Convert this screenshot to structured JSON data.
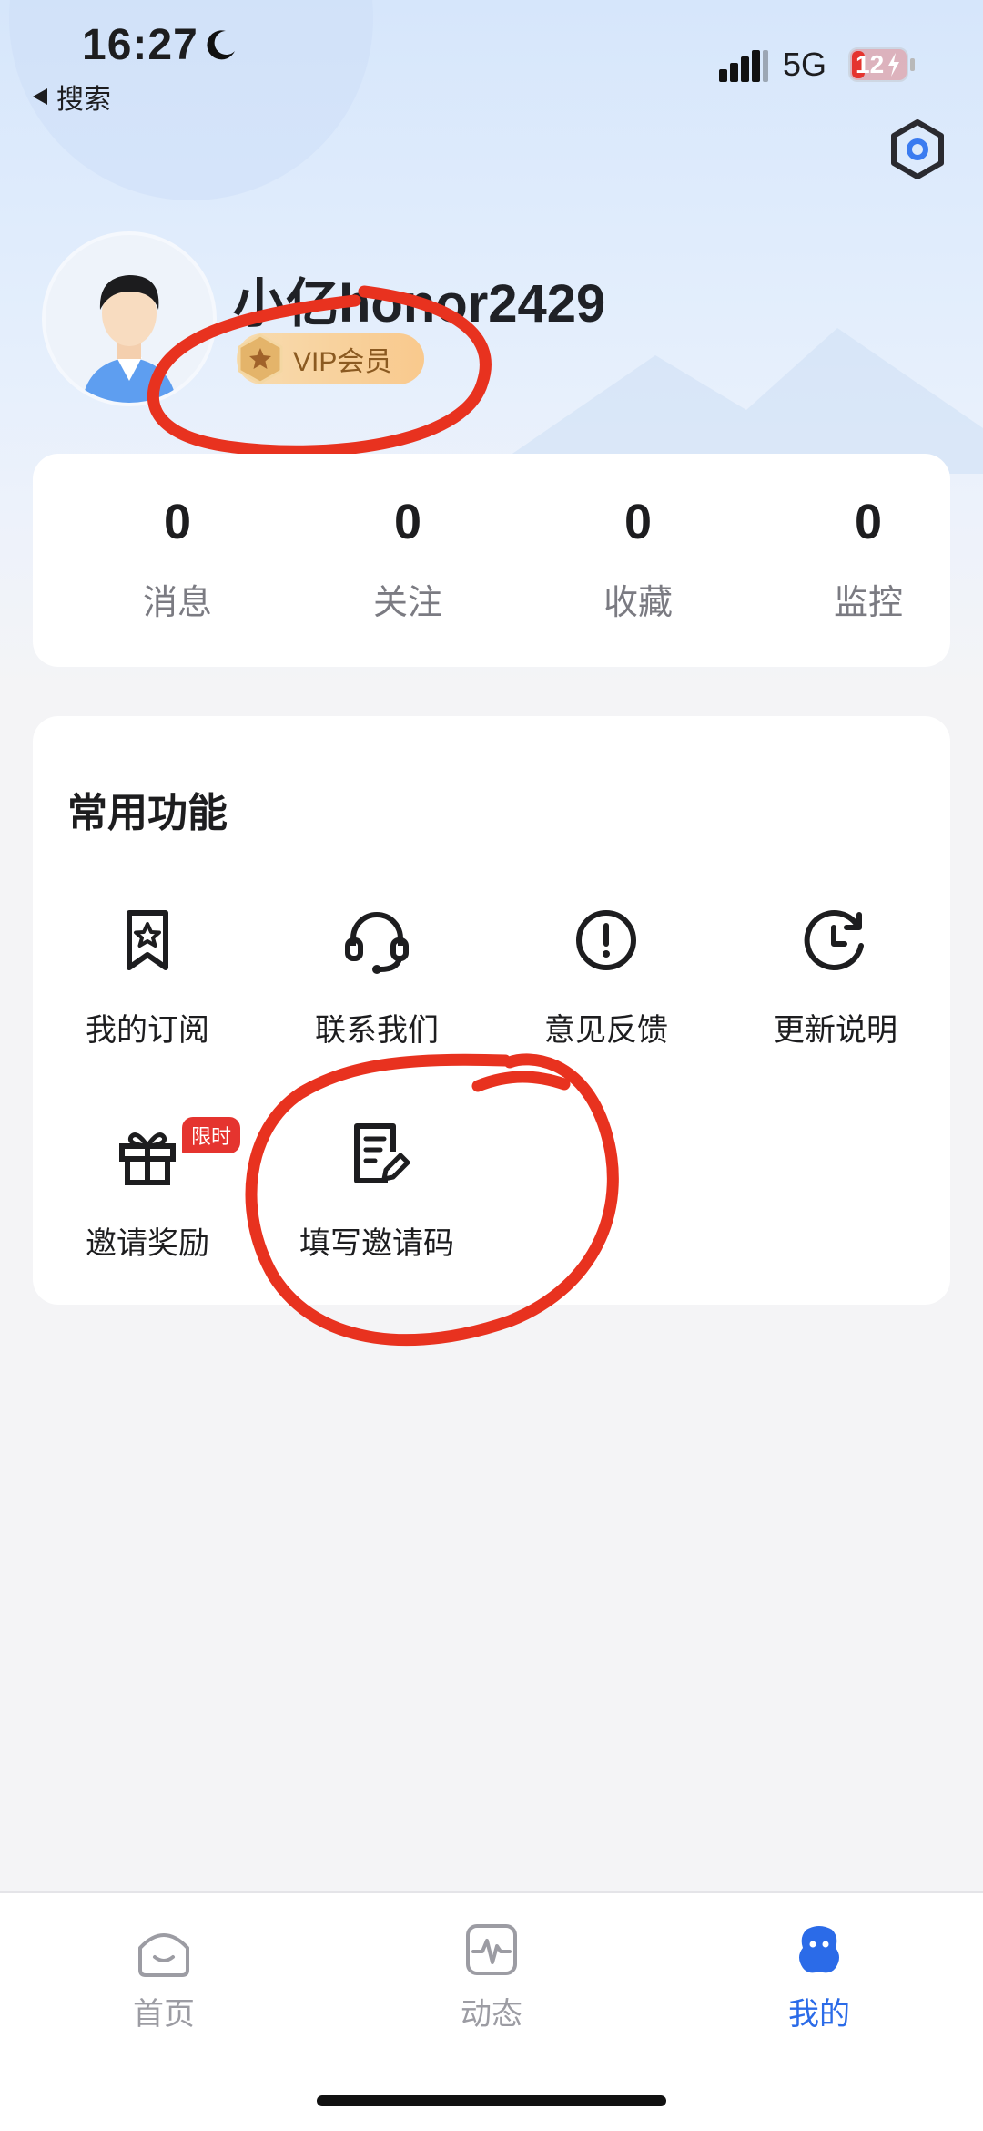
{
  "status_bar": {
    "time": "16:27",
    "back_label": "搜索",
    "network": "5G",
    "battery": "12"
  },
  "profile": {
    "username": "小亿honor2429",
    "vip_label": "VIP会员"
  },
  "stats": [
    {
      "value": "0",
      "label": "消息"
    },
    {
      "value": "0",
      "label": "关注"
    },
    {
      "value": "0",
      "label": "收藏"
    },
    {
      "value": "0",
      "label": "监控"
    }
  ],
  "functions": {
    "title": "常用功能",
    "items": [
      {
        "label": "我的订阅",
        "icon": "bookmark-star-icon"
      },
      {
        "label": "联系我们",
        "icon": "headset-icon"
      },
      {
        "label": "意见反馈",
        "icon": "exclamation-circle-icon"
      },
      {
        "label": "更新说明",
        "icon": "clock-refresh-icon"
      },
      {
        "label": "邀请奖励",
        "icon": "gift-icon",
        "tag": "限时"
      },
      {
        "label": "填写邀请码",
        "icon": "document-edit-icon"
      }
    ]
  },
  "tabs": [
    {
      "label": "首页",
      "icon": "home-icon"
    },
    {
      "label": "动态",
      "icon": "activity-icon"
    },
    {
      "label": "我的",
      "icon": "profile-icon",
      "active": true
    }
  ],
  "colors": {
    "accent": "#2b6be8",
    "annotation": "#e8321f",
    "vip_gold": "#f9c98d",
    "tag_red": "#e5342f"
  }
}
